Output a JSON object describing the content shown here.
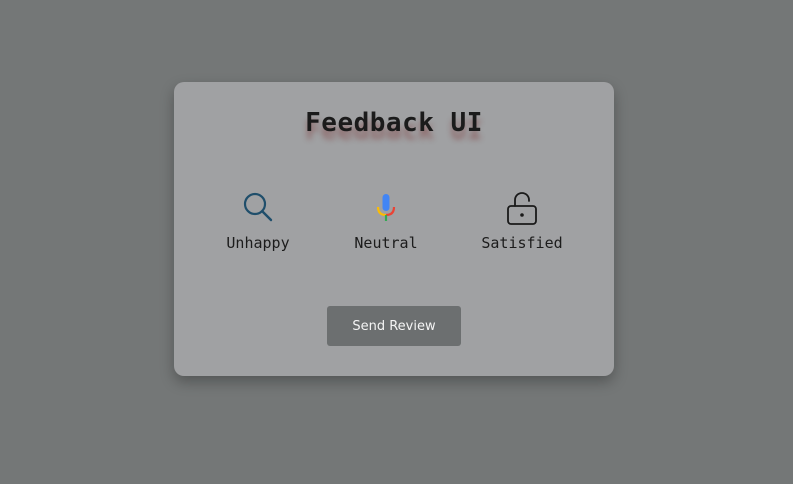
{
  "card": {
    "title": "Feedback UI"
  },
  "options": [
    {
      "label": "Unhappy",
      "icon": "search-icon"
    },
    {
      "label": "Neutral",
      "icon": "microphone-icon"
    },
    {
      "label": "Satisfied",
      "icon": "unlock-icon"
    }
  ],
  "actions": {
    "send_label": "Send Review"
  },
  "colors": {
    "page_background": "#747777",
    "card_background": "#a0a1a3",
    "button_background": "#6c6f70",
    "search_icon": "#1f4e6b",
    "mic_blue": "#4285f4",
    "mic_red": "#ea4335",
    "mic_yellow": "#fbbc05",
    "mic_green": "#34a853"
  }
}
